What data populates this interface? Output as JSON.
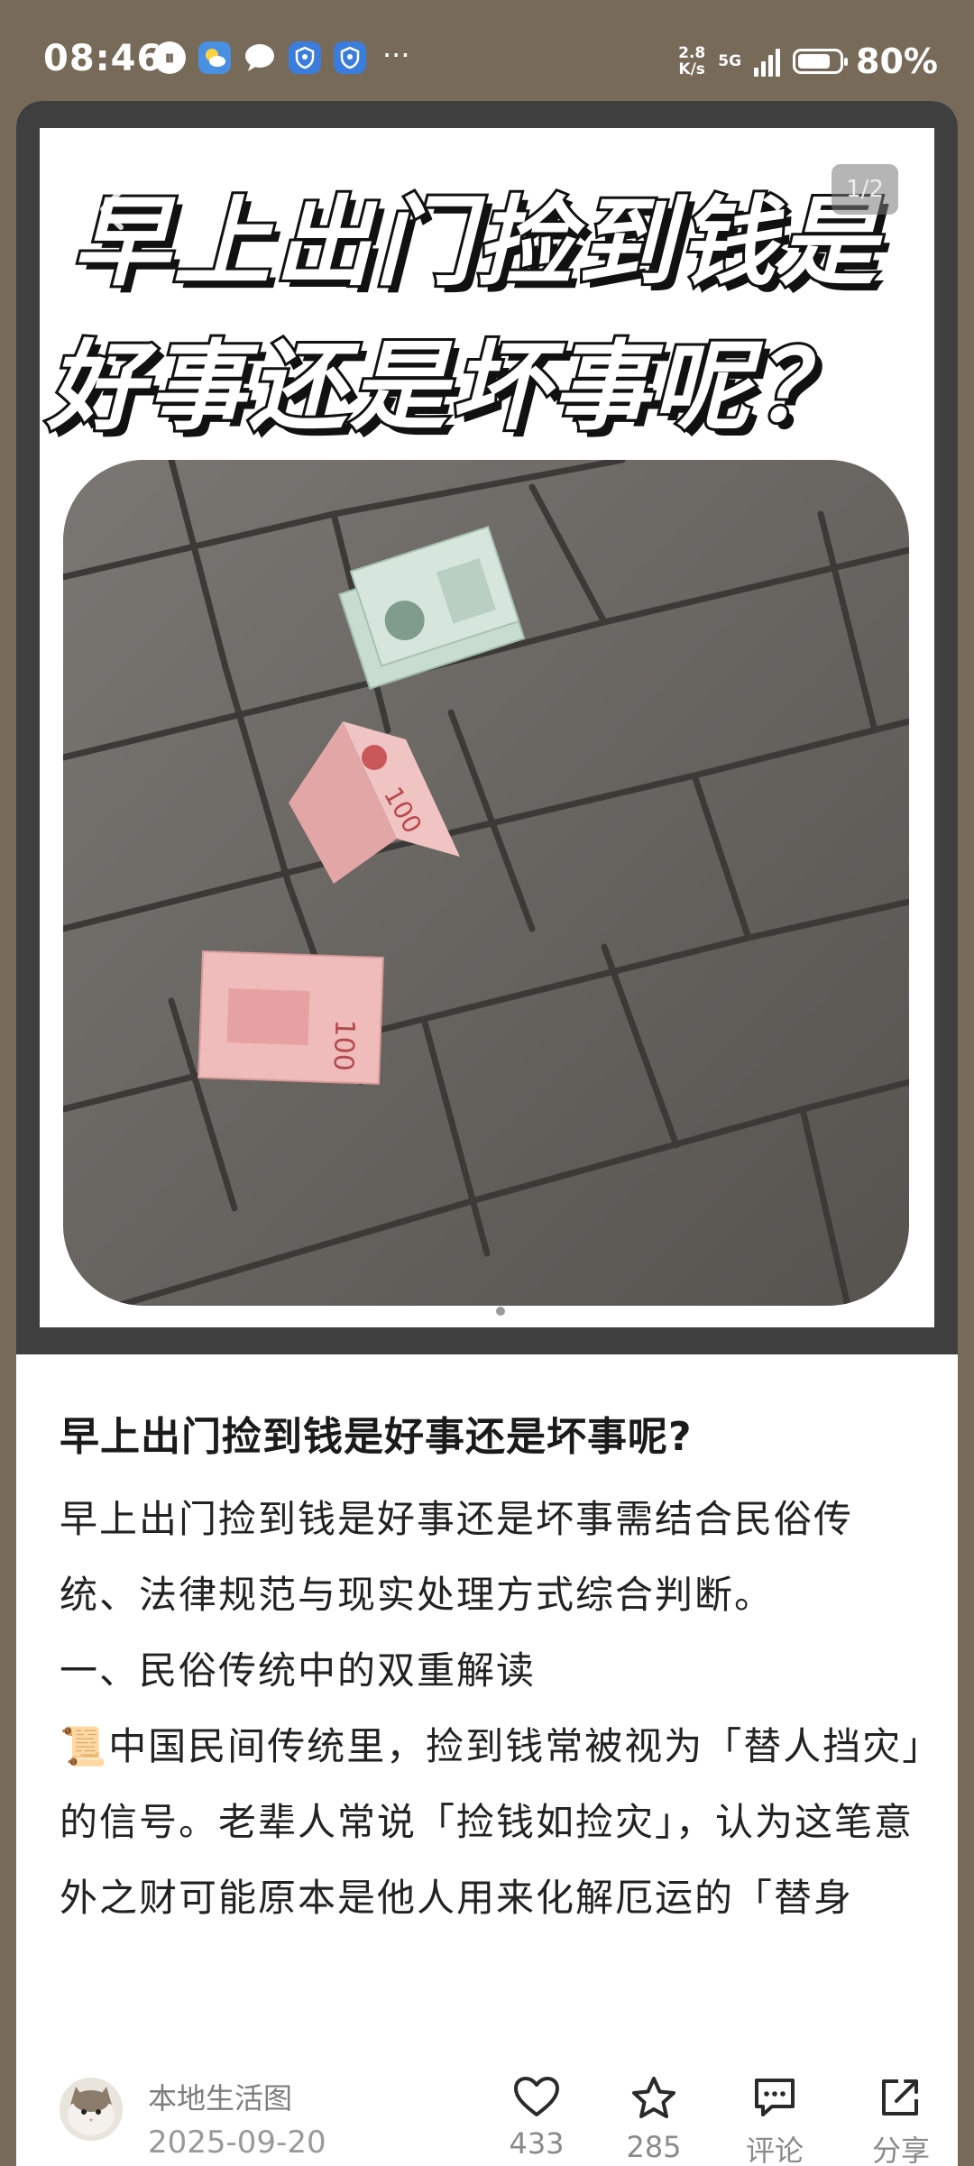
{
  "status_bar": {
    "time": "08:46",
    "net_speed_value": "2.8",
    "net_speed_unit": "K/s",
    "network": "5G",
    "battery": "80%",
    "battery_level": 0.8
  },
  "image": {
    "headline_line1": "早上出门捡到钱是",
    "headline_line2": "好事还是坏事呢？",
    "counter": "1/2",
    "current_index": 1,
    "total": 2
  },
  "article": {
    "title": "早上出门捡到钱是好事还是坏事呢?",
    "paragraphs": [
      "早上出门捡到钱是好事还是坏事需结合民俗传统、法律规范与现实处理方式综合判断。",
      "一、民俗传统中的双重解读",
      "📜中国民间传统里，捡到钱常被视为「替人挡灾」的信号。老辈人常说「捡钱如捡灾」，认为这笔意外之财可能原本是他人用来化解厄运的「替身钱」，若占为己有，反而可能承接对"
    ]
  },
  "bottom_bar": {
    "author": "本地生活图",
    "date": "2025-09-20",
    "like_count": "433",
    "favorite_count": "285",
    "comment_label": "评论",
    "share_label": "分享"
  }
}
